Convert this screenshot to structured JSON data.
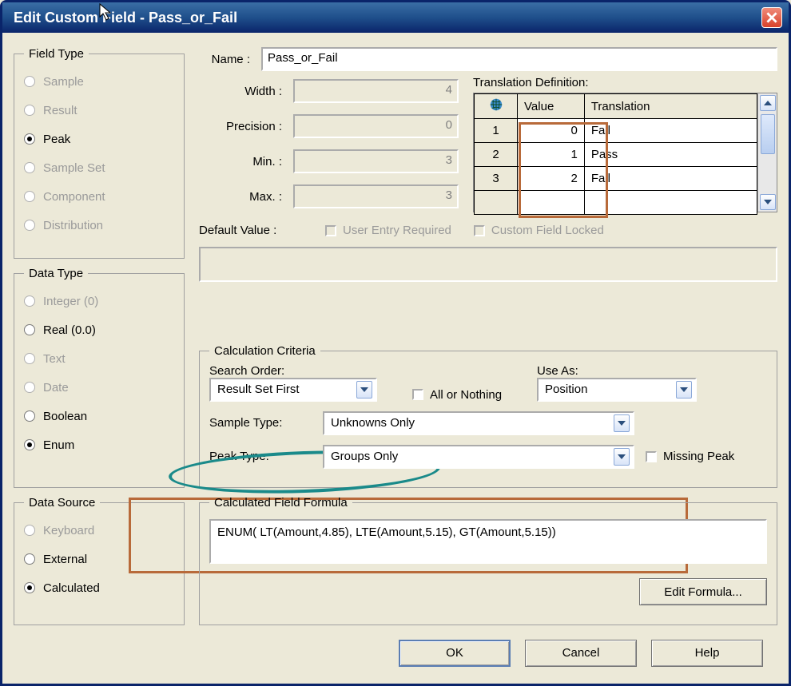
{
  "title": "Edit Custom Field - Pass_or_Fail",
  "field_type": {
    "legend": "Field Type",
    "options": [
      {
        "label": "Sample",
        "enabled": false,
        "selected": false
      },
      {
        "label": "Result",
        "enabled": false,
        "selected": false
      },
      {
        "label": "Peak",
        "enabled": true,
        "selected": true
      },
      {
        "label": "Sample Set",
        "enabled": false,
        "selected": false
      },
      {
        "label": "Component",
        "enabled": false,
        "selected": false
      },
      {
        "label": "Distribution",
        "enabled": false,
        "selected": false
      }
    ]
  },
  "data_type": {
    "legend": "Data Type",
    "options": [
      {
        "label": "Integer (0)",
        "enabled": false,
        "selected": false
      },
      {
        "label": "Real (0.0)",
        "enabled": true,
        "selected": false
      },
      {
        "label": "Text",
        "enabled": false,
        "selected": false
      },
      {
        "label": "Date",
        "enabled": false,
        "selected": false
      },
      {
        "label": "Boolean",
        "enabled": true,
        "selected": false
      },
      {
        "label": "Enum",
        "enabled": true,
        "selected": true
      }
    ]
  },
  "data_source": {
    "legend": "Data Source",
    "options": [
      {
        "label": "Keyboard",
        "enabled": false,
        "selected": false
      },
      {
        "label": "External",
        "enabled": true,
        "selected": false
      },
      {
        "label": "Calculated",
        "enabled": true,
        "selected": true
      }
    ]
  },
  "props": {
    "name_label": "Name :",
    "name_value": "Pass_or_Fail",
    "width_label": "Width :",
    "width_value": "4",
    "precision_label": "Precision :",
    "precision_value": "0",
    "min_label": "Min. :",
    "min_value": "3",
    "max_label": "Max. :",
    "max_value": "3",
    "default_label": "Default Value :",
    "user_entry_label": "User Entry Required",
    "locked_label": "Custom Field Locked"
  },
  "translation": {
    "label": "Translation Definition:",
    "headers": {
      "value": "Value",
      "translation": "Translation"
    },
    "rows": [
      {
        "i": "1",
        "value": "0",
        "text": "Fail"
      },
      {
        "i": "2",
        "value": "1",
        "text": "Pass"
      },
      {
        "i": "3",
        "value": "2",
        "text": "Fail"
      }
    ]
  },
  "calc": {
    "legend": "Calculation Criteria",
    "search_order_label": "Search Order:",
    "search_order_value": "Result Set First",
    "all_or_nothing_label": "All or Nothing",
    "use_as_label": "Use As:",
    "use_as_value": "Position",
    "sample_type_label": "Sample Type:",
    "sample_type_value": "Unknowns Only",
    "peak_type_label": "Peak Type:",
    "peak_type_value": "Groups Only",
    "missing_peak_label": "Missing Peak"
  },
  "formula": {
    "legend": "Calculated Field Formula",
    "text": "ENUM( LT(Amount,4.85), LTE(Amount,5.15), GT(Amount,5.15))",
    "edit_label": "Edit Formula..."
  },
  "buttons": {
    "ok": "OK",
    "cancel": "Cancel",
    "help": "Help"
  }
}
